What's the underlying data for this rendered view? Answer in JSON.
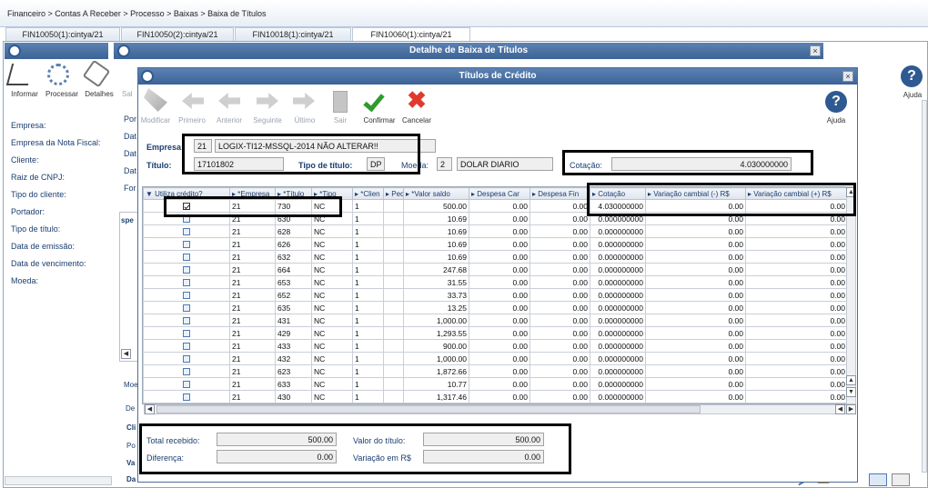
{
  "breadcrumb": "Financeiro > Contas A Receber > Processo > Baixas > Baixa de Títulos",
  "tabs": [
    "FIN10050(1):cintya/21",
    "FIN10050(2):cintya/21",
    "FIN10018(1):cintya/21",
    "FIN10060(1):cintya/21"
  ],
  "main_window": {
    "title": "Detalhe de Baixa de Títulos",
    "toolbar": {
      "informar": "Informar",
      "processar": "Processar",
      "detalhes": "Detalhes",
      "sal": "Sal",
      "ajuda": "Ajuda"
    },
    "left_labels": [
      "Empresa:",
      "Empresa da Nota Fiscal:",
      "Cliente:",
      "Raiz de CNPJ:",
      "Tipo do cliente:",
      "Portador:",
      "Tipo de título:",
      "Data de emissão:",
      "Data de vencimento:",
      "Moeda:"
    ],
    "mid_labels": [
      "Por",
      "Dat",
      "Dat",
      "Dat",
      "For"
    ],
    "misc": {
      "spe": "spe",
      "mo": "Moe",
      "de": "De",
      "cli": "Cli",
      "po": "Po",
      "va": "Va",
      "da": "Da"
    }
  },
  "dialog": {
    "title": "Títulos de Crédito",
    "toolbar": [
      "Modificar",
      "Primeiro",
      "Anterior",
      "Seguinte",
      "Último",
      "Sair",
      "Confirmar",
      "Cancelar"
    ],
    "ajuda": "Ajuda",
    "empresa_label": "Empresa:",
    "empresa_code": "21",
    "empresa_name": "LOGIX-TI12-MSSQL-2014 NÃO ALTERAR!!",
    "titulo_label": "Título:",
    "titulo_value": "17101802",
    "tipo_titulo_label": "Tipo de título:",
    "tipo_titulo_value": "DP",
    "moeda_label": "Moeda:",
    "moeda_code": "2",
    "moeda_name": "DOLAR DIARIO",
    "cotacao_label": "Cotação:",
    "cotacao_value": "4.030000000",
    "columns": [
      "Utiliza crédito?",
      "*Empresa",
      "*Título",
      "*Tipo",
      "*Clien",
      "Pec",
      "*Valor saldo",
      "Despesa Car",
      "Despesa Fin",
      "Cotação",
      "Variação cambial (-) R$",
      "Variação cambial (+) R$"
    ],
    "rows": [
      {
        "check": true,
        "emp": "21",
        "tit": "730",
        "tipo": "NC",
        "cli": "1",
        "valor": "500.00",
        "dc": "0.00",
        "df": "0.00",
        "cot": "4.030000000",
        "vneg": "0.00",
        "vpos": "0.00"
      },
      {
        "check": false,
        "emp": "21",
        "tit": "630",
        "tipo": "NC",
        "cli": "1",
        "valor": "10.69",
        "dc": "0.00",
        "df": "0.00",
        "cot": "0.000000000",
        "vneg": "0.00",
        "vpos": "0.00"
      },
      {
        "check": false,
        "emp": "21",
        "tit": "628",
        "tipo": "NC",
        "cli": "1",
        "valor": "10.69",
        "dc": "0.00",
        "df": "0.00",
        "cot": "0.000000000",
        "vneg": "0.00",
        "vpos": "0.00"
      },
      {
        "check": false,
        "emp": "21",
        "tit": "626",
        "tipo": "NC",
        "cli": "1",
        "valor": "10.69",
        "dc": "0.00",
        "df": "0.00",
        "cot": "0.000000000",
        "vneg": "0.00",
        "vpos": "0.00"
      },
      {
        "check": false,
        "emp": "21",
        "tit": "632",
        "tipo": "NC",
        "cli": "1",
        "valor": "10.69",
        "dc": "0.00",
        "df": "0.00",
        "cot": "0.000000000",
        "vneg": "0.00",
        "vpos": "0.00"
      },
      {
        "check": false,
        "emp": "21",
        "tit": "664",
        "tipo": "NC",
        "cli": "1",
        "valor": "247.68",
        "dc": "0.00",
        "df": "0.00",
        "cot": "0.000000000",
        "vneg": "0.00",
        "vpos": "0.00"
      },
      {
        "check": false,
        "emp": "21",
        "tit": "653",
        "tipo": "NC",
        "cli": "1",
        "valor": "31.55",
        "dc": "0.00",
        "df": "0.00",
        "cot": "0.000000000",
        "vneg": "0.00",
        "vpos": "0.00"
      },
      {
        "check": false,
        "emp": "21",
        "tit": "652",
        "tipo": "NC",
        "cli": "1",
        "valor": "33.73",
        "dc": "0.00",
        "df": "0.00",
        "cot": "0.000000000",
        "vneg": "0.00",
        "vpos": "0.00"
      },
      {
        "check": false,
        "emp": "21",
        "tit": "635",
        "tipo": "NC",
        "cli": "1",
        "valor": "13.25",
        "dc": "0.00",
        "df": "0.00",
        "cot": "0.000000000",
        "vneg": "0.00",
        "vpos": "0.00"
      },
      {
        "check": false,
        "emp": "21",
        "tit": "431",
        "tipo": "NC",
        "cli": "1",
        "valor": "1,000.00",
        "dc": "0.00",
        "df": "0.00",
        "cot": "0.000000000",
        "vneg": "0.00",
        "vpos": "0.00"
      },
      {
        "check": false,
        "emp": "21",
        "tit": "429",
        "tipo": "NC",
        "cli": "1",
        "valor": "1,293.55",
        "dc": "0.00",
        "df": "0.00",
        "cot": "0.000000000",
        "vneg": "0.00",
        "vpos": "0.00"
      },
      {
        "check": false,
        "emp": "21",
        "tit": "433",
        "tipo": "NC",
        "cli": "1",
        "valor": "900.00",
        "dc": "0.00",
        "df": "0.00",
        "cot": "0.000000000",
        "vneg": "0.00",
        "vpos": "0.00"
      },
      {
        "check": false,
        "emp": "21",
        "tit": "432",
        "tipo": "NC",
        "cli": "1",
        "valor": "1,000.00",
        "dc": "0.00",
        "df": "0.00",
        "cot": "0.000000000",
        "vneg": "0.00",
        "vpos": "0.00"
      },
      {
        "check": false,
        "emp": "21",
        "tit": "623",
        "tipo": "NC",
        "cli": "1",
        "valor": "1,872.66",
        "dc": "0.00",
        "df": "0.00",
        "cot": "0.000000000",
        "vneg": "0.00",
        "vpos": "0.00"
      },
      {
        "check": false,
        "emp": "21",
        "tit": "633",
        "tipo": "NC",
        "cli": "1",
        "valor": "10.77",
        "dc": "0.00",
        "df": "0.00",
        "cot": "0.000000000",
        "vneg": "0.00",
        "vpos": "0.00"
      },
      {
        "check": false,
        "emp": "21",
        "tit": "430",
        "tipo": "NC",
        "cli": "1",
        "valor": "1,317.46",
        "dc": "0.00",
        "df": "0.00",
        "cot": "0.000000000",
        "vneg": "0.00",
        "vpos": "0.00"
      }
    ],
    "totals": {
      "total_recebido_label": "Total recebido:",
      "total_recebido": "500.00",
      "diferenca_label": "Diferença:",
      "diferenca": "0.00",
      "valor_titulo_label": "Valor do título:",
      "valor_titulo": "500.00",
      "variacao_label": "Variação em R$",
      "variacao": "0.00"
    }
  }
}
